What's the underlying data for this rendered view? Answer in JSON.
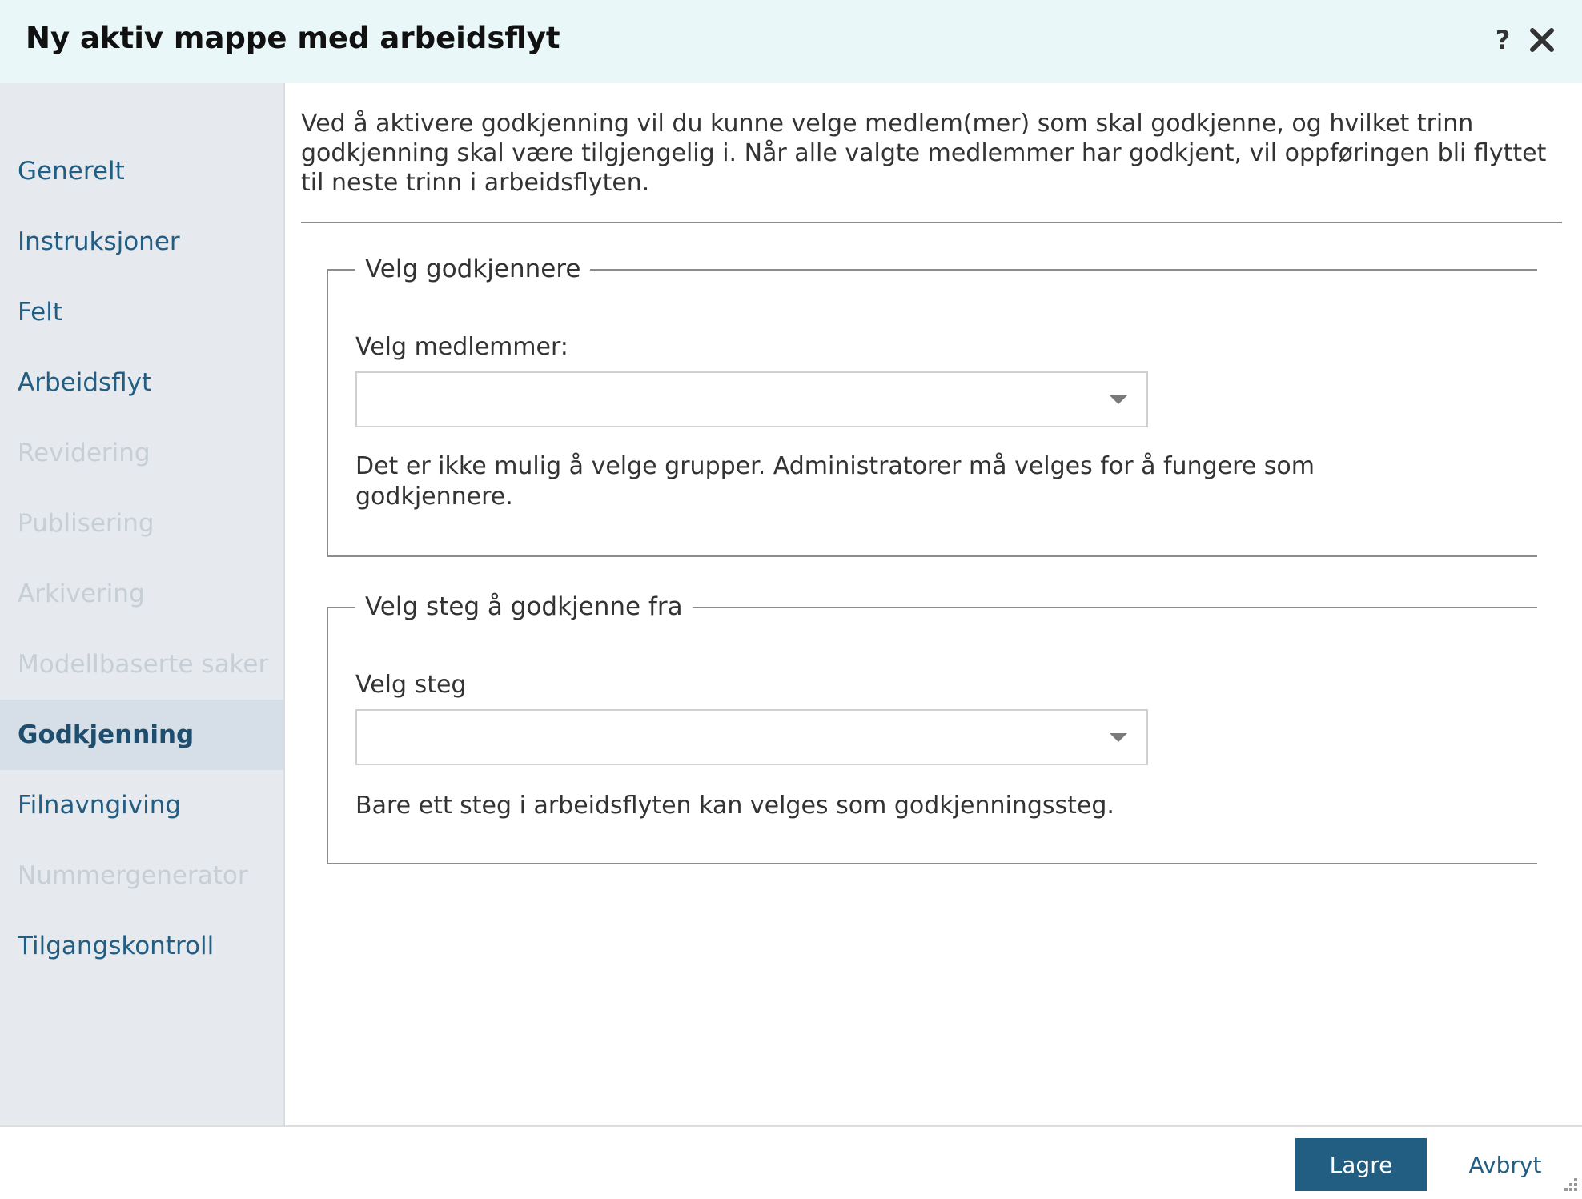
{
  "dialog": {
    "title": "Ny aktiv mappe med arbeidsflyt",
    "help_label": "?"
  },
  "sidebar": {
    "items": [
      {
        "label": "Generelt",
        "state": "enabled"
      },
      {
        "label": "Instruksjoner",
        "state": "enabled"
      },
      {
        "label": "Felt",
        "state": "enabled"
      },
      {
        "label": "Arbeidsflyt",
        "state": "enabled"
      },
      {
        "label": "Revidering",
        "state": "disabled"
      },
      {
        "label": "Publisering",
        "state": "disabled"
      },
      {
        "label": "Arkivering",
        "state": "disabled"
      },
      {
        "label": "Modellbaserte saker",
        "state": "disabled"
      },
      {
        "label": "Godkjenning",
        "state": "active"
      },
      {
        "label": "Filnavngiving",
        "state": "enabled"
      },
      {
        "label": "Nummergenerator",
        "state": "disabled"
      },
      {
        "label": "Tilgangskontroll",
        "state": "enabled"
      }
    ]
  },
  "main": {
    "intro": "Ved å aktivere godkjenning vil du kunne velge medlem(mer) som skal godkjenne, og hvilket trinn godkjenning skal være tilgjengelig i. Når alle valgte medlemmer har godkjent, vil oppføringen bli flyttet til neste trinn i arbeidsflyten.",
    "approvers": {
      "legend": "Velg godkjennere",
      "label": "Velg medlemmer:",
      "value": "",
      "hint": "Det er ikke mulig å velge grupper. Administratorer må velges for å fungere som godkjennere."
    },
    "step": {
      "legend": "Velg steg å godkjenne fra",
      "label": "Velg steg",
      "value": "",
      "hint": "Bare ett steg i arbeidsflyten kan velges som godkjenningssteg."
    }
  },
  "footer": {
    "save_label": "Lagre",
    "cancel_label": "Avbryt"
  },
  "colors": {
    "titlebar_bg": "#e9f7f9",
    "sidebar_bg": "#e6eaee",
    "link": "#225e84",
    "primary_button": "#215e82",
    "disabled_text": "#c6ced6"
  },
  "icons": {
    "help": "help-icon",
    "close": "close-icon",
    "dropdown": "chevron-down-icon",
    "resize": "resize-grip-icon"
  }
}
